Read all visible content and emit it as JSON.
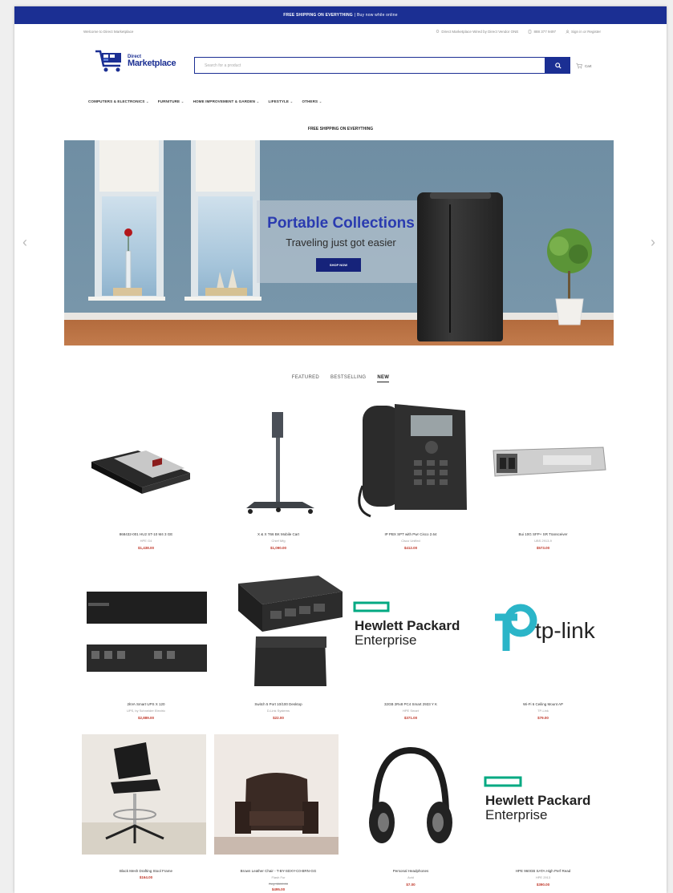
{
  "announcement": {
    "bold": "FREE SHIPPING ON EVERYTHING",
    "rest": "| Buy now while online"
  },
  "utility": {
    "left": "Welcome to Direct Marketplace",
    "seller": "Direct Marketplace Wired by Direct Vendor ONE",
    "phone": "888 377 9497",
    "account": "Sign in or Register"
  },
  "logo": {
    "line1": "Direct",
    "line2": "Marketplace"
  },
  "search": {
    "placeholder": "Search for a product"
  },
  "cart": {
    "label": "Cart"
  },
  "nav": [
    "COMPUTERS & ELECTRONICS",
    "FURNITURE",
    "HOME IMPROVEMENT & GARDEN",
    "LIFESTYLE",
    "OTHERS"
  ],
  "free_shipping": "FREE SHIPPING ON EVERYTHING",
  "hero": {
    "title": "Portable Collections",
    "subtitle": "Traveling just got easier",
    "button": "SHOP NOW"
  },
  "tabs": [
    "FEATURED",
    "BESTSELLING",
    "NEW"
  ],
  "products": [
    {
      "name": "868432-001 HU2 ST-10 M4 3 GE",
      "brand": "HPE G4",
      "old": "",
      "price": "$1,438.00"
    },
    {
      "name": "X & X T66 BK Mobile Cart",
      "brand": "Chief Mfg",
      "old": "",
      "price": "$1,090.00"
    },
    {
      "name": "IP PBX SPT with Pwr Cisco 2.64",
      "brand": "Cisco Unified",
      "old": "",
      "price": "$412.00"
    },
    {
      "name": "Bui 10G SFP+ SR Transceiver",
      "brand": "UBS 2913-9",
      "old": "",
      "price": "$573.00"
    },
    {
      "name": "2kVA Smart UPS X 120",
      "brand": "UPS, by Schneider Electric",
      "old": "",
      "price": "$2,889.00"
    },
    {
      "name": "Switch 5 Port 10/100 Desktop",
      "brand": "D-Link Systems",
      "old": "",
      "price": "$22.00"
    },
    {
      "name": "32GB 2Rx8 PC4 Smart 2933 Y K",
      "brand": "HPE Smart",
      "old": "",
      "price": "$371.00"
    },
    {
      "name": "Wi-Fi 6 Ceiling Mount AP",
      "brand": "TP-Link",
      "old": "",
      "price": "$79.00"
    },
    {
      "name": "Black Mesh Drafting Stool Frame",
      "brand": "",
      "old": "",
      "price": "$164.00"
    },
    {
      "name": "Brown Leather Chair - T-BY-SDXY-C0-BRN-GG",
      "brand": "Flash Fur",
      "old": "Reg. $599.00",
      "price": "$495.00"
    },
    {
      "name": "Personal Headphones",
      "brand": "Avid",
      "old": "",
      "price": "$7.00"
    },
    {
      "name": "HPE 960GB SATA High Perf Read",
      "brand": "HPE 2913",
      "old": "",
      "price": "$390.00"
    }
  ]
}
